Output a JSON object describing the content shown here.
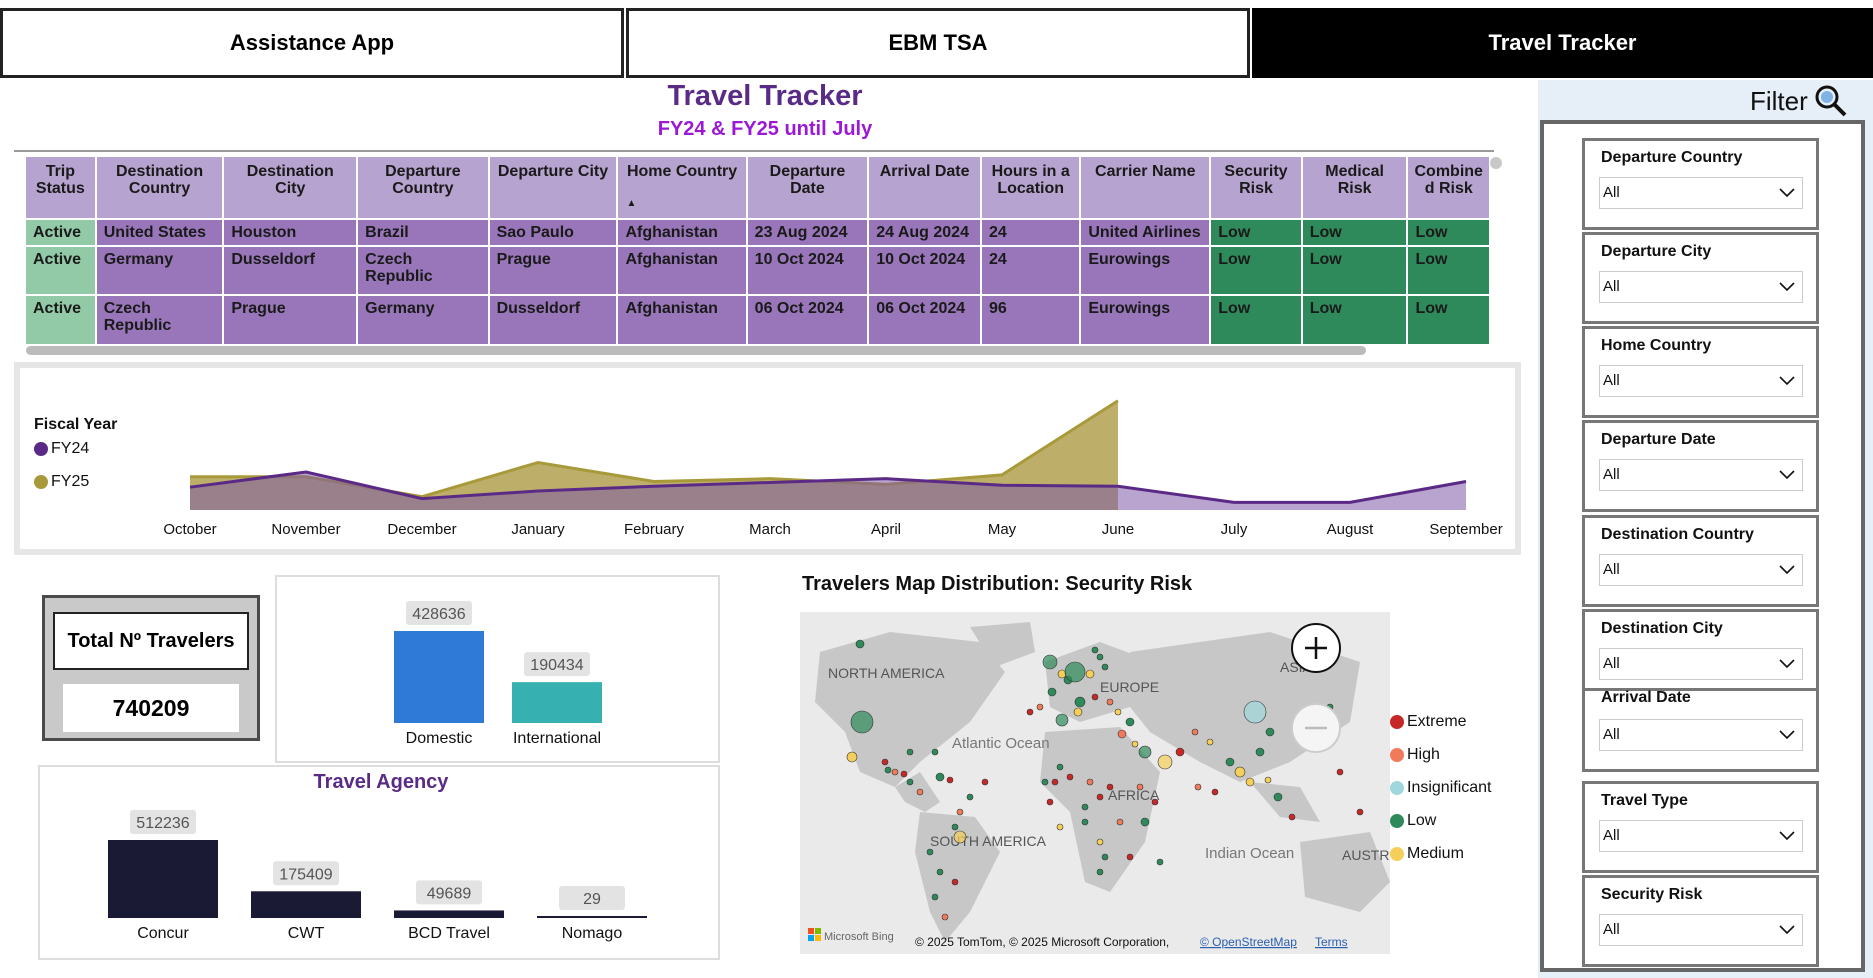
{
  "tabs": [
    {
      "label": "Assistance App"
    },
    {
      "label": "EBM TSA"
    },
    {
      "label": "Travel Tracker"
    }
  ],
  "header": {
    "title": "Travel Tracker",
    "subtitle": "FY24 & FY25 until July"
  },
  "trips_table": {
    "columns": [
      "Trip Status",
      "Destination Country",
      "Destination City",
      "Departure Country",
      "Departure City",
      "Home Country",
      "Departure Date",
      "Arrival Date",
      "Hours in a Location",
      "Carrier Name",
      "Security Risk",
      "Medical Risk",
      "Combined Risk"
    ],
    "rows": [
      [
        "Active",
        "United States",
        "Houston",
        "Brazil",
        "Sao Paulo",
        "Afghanistan",
        "23 Aug 2024",
        "24 Aug 2024",
        "24",
        "United Airlines",
        "Low",
        "Low",
        "Low"
      ],
      [
        "Active",
        "Germany",
        "Dusseldorf",
        "Czech Republic",
        "Prague",
        "Afghanistan",
        "10 Oct 2024",
        "10 Oct 2024",
        "24",
        "Eurowings",
        "Low",
        "Low",
        "Low"
      ],
      [
        "Active",
        "Czech Republic",
        "Prague",
        "Germany",
        "Dusseldorf",
        "Afghanistan",
        "06 Oct 2024",
        "06 Oct 2024",
        "96",
        "Eurowings",
        "Low",
        "Low",
        "Low"
      ]
    ]
  },
  "chart_data": [
    {
      "type": "area",
      "legend_title": "Fiscal Year",
      "legend_placement": "left",
      "categories": [
        "October",
        "November",
        "December",
        "January",
        "February",
        "March",
        "April",
        "May",
        "June",
        "July",
        "August",
        "September"
      ],
      "series": [
        {
          "name": "FY24",
          "color": "#5b2a86",
          "values": [
            24,
            40,
            12,
            20,
            25,
            29,
            33,
            26,
            25,
            8,
            8,
            30
          ]
        },
        {
          "name": "FY25",
          "color": "#a89a3a",
          "values": [
            35,
            35,
            14,
            50,
            30,
            33,
            27,
            37,
            115
          ]
        }
      ],
      "grid": false
    },
    {
      "type": "bar",
      "categories": [
        "Domestic",
        "International"
      ],
      "values": [
        428636,
        190434
      ],
      "colors": [
        "#2f7ad6",
        "#36b0b0"
      ]
    },
    {
      "type": "bar",
      "title": "Travel Agency",
      "categories": [
        "Concur",
        "CWT",
        "BCD Travel",
        "Nomago"
      ],
      "values": [
        512236,
        175409,
        49689,
        29
      ],
      "colors": [
        "#1b1a35",
        "#1b1a35",
        "#1b1a35",
        "#1b1a35"
      ]
    }
  ],
  "travelers_card": {
    "label": "Total Nº Travelers",
    "value": "740209"
  },
  "map": {
    "title": "Travelers Map Distribution: Security Risk",
    "labels": [
      "NORTH AMERICA",
      "EUROPE",
      "ASIA",
      "Atlantic Ocean",
      "AFRICA",
      "SOUTH AMERICA",
      "Indian Ocean",
      "AUSTR"
    ],
    "attribution": "© 2025 TomTom, © 2025 Microsoft Corporation,",
    "osm_link": "© OpenStreetMap",
    "terms_link": "Terms",
    "bing_label": "Microsoft Bing",
    "legend": [
      {
        "label": "Extreme",
        "color": "#c62828"
      },
      {
        "label": "High",
        "color": "#f07a5a"
      },
      {
        "label": "Insignificant",
        "color": "#9fd8dc"
      },
      {
        "label": "Low",
        "color": "#2e8a5a"
      },
      {
        "label": "Medium",
        "color": "#f5cf5a"
      }
    ]
  },
  "filter": {
    "title": "Filter",
    "slicers": [
      {
        "label": "Departure Country",
        "value": "All"
      },
      {
        "label": "Departure City",
        "value": "All"
      },
      {
        "label": "Home Country",
        "value": "All"
      },
      {
        "label": "Departure Date",
        "value": "All"
      },
      {
        "label": "Destination Country",
        "value": "All"
      },
      {
        "label": "Destination City",
        "value": "All"
      },
      {
        "label": "Arrival Date",
        "value": "All"
      },
      {
        "label": "Travel Type",
        "value": "All"
      },
      {
        "label": "Security Risk",
        "value": "All"
      }
    ]
  }
}
